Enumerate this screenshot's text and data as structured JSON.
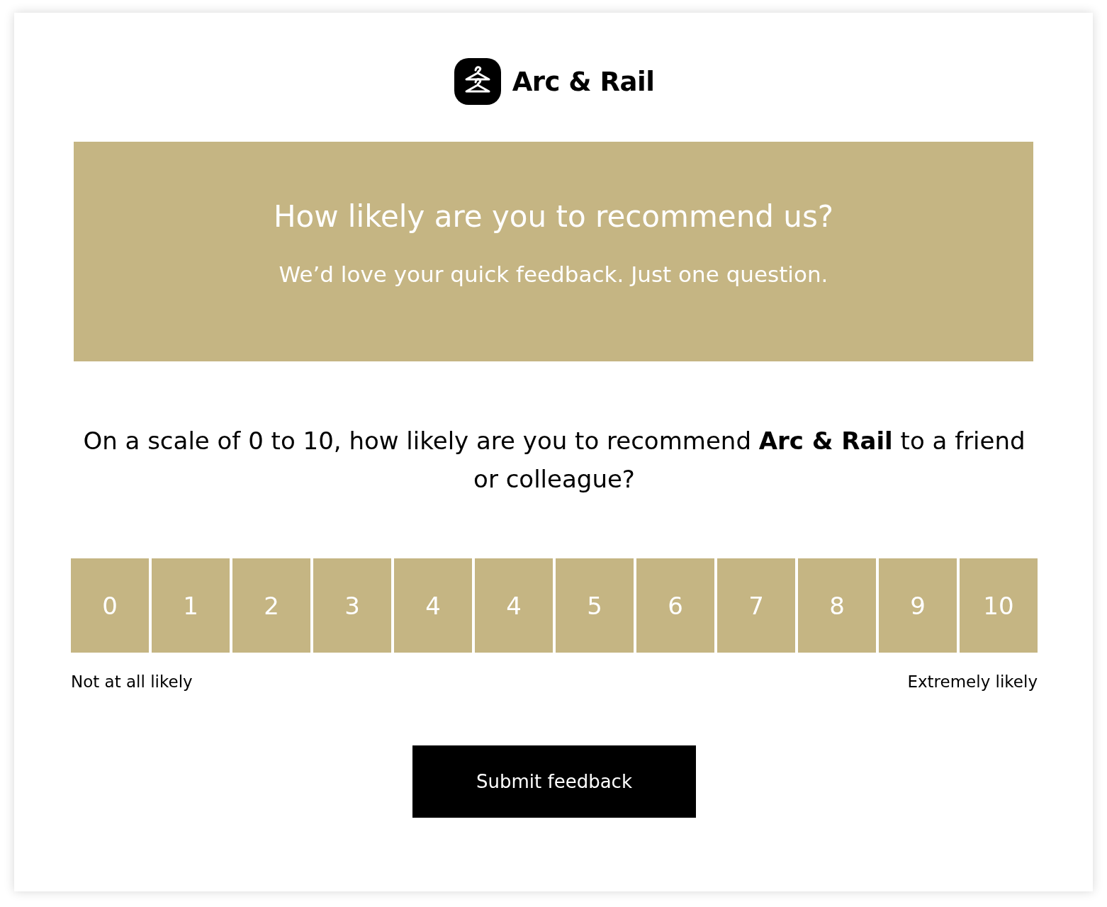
{
  "brand": {
    "name": "Arc & Rail"
  },
  "banner": {
    "title": "How likely are you to recommend us?",
    "subtitle": "We’d love your quick feedback. Just one question."
  },
  "question": "On a scale of 0 to 10, how likely are you to recommend **Arc & Rail** to a friend or colleague?",
  "scale": {
    "options": [
      {
        "label": "0",
        "selected": false
      },
      {
        "label": "1",
        "selected": false
      },
      {
        "label": "2",
        "selected": false
      },
      {
        "label": "3",
        "selected": false
      },
      {
        "label": "4",
        "selected": false
      },
      {
        "label": "4",
        "selected": false
      },
      {
        "label": "5",
        "selected": false
      },
      {
        "label": "6",
        "selected": false
      },
      {
        "label": "7",
        "selected": false
      },
      {
        "label": "8",
        "selected": false
      },
      {
        "label": "9",
        "selected": false
      },
      {
        "label": "10",
        "selected": false
      }
    ],
    "low_label": "Not at all likely",
    "high_label": "Extremely likely"
  },
  "submit_button": "Submit feedback"
}
